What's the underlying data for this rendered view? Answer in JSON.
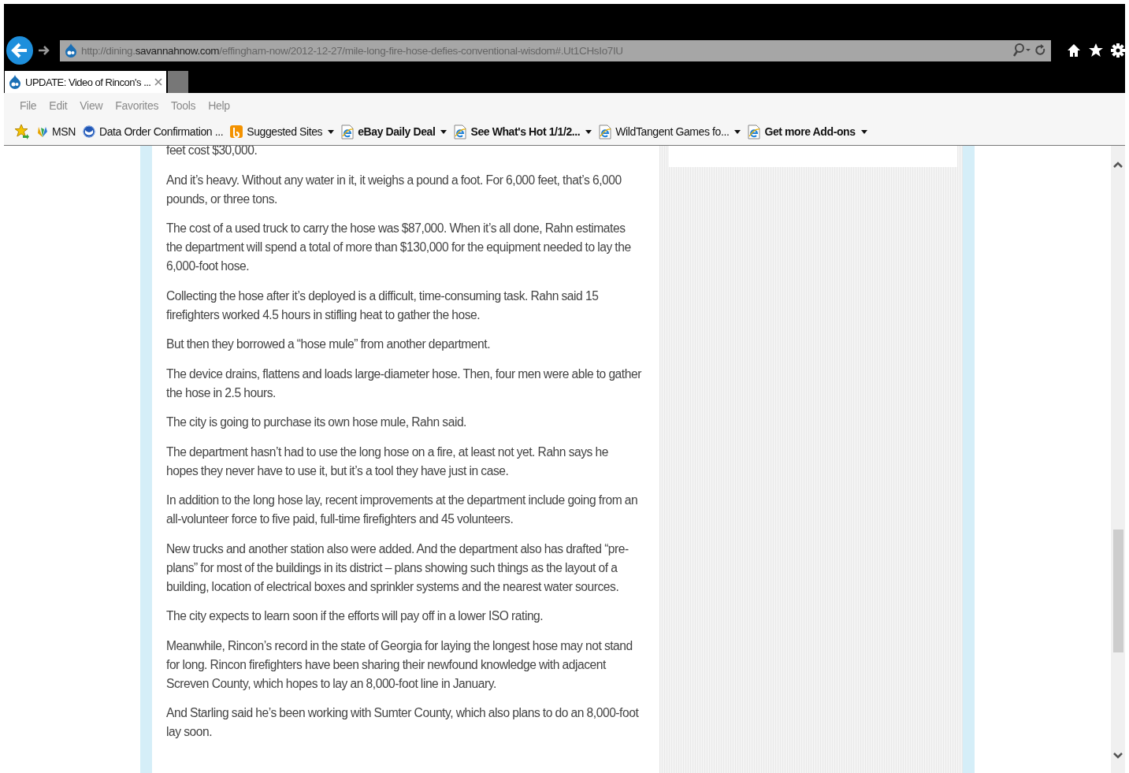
{
  "browser": {
    "address": "http://dining.**savannahnow.com**/effingham-now/2012-12-27/mile-long-fire-hose-defies-conventional-wisdom#.Ut1CHsIo7IU",
    "tabs": [
      {
        "title": "UPDATE: Video of Rincon's ...",
        "selected": true
      }
    ],
    "menu": [
      "File",
      "Edit",
      "View",
      "Favorites",
      "Tools",
      "Help"
    ],
    "favorites": [
      {
        "label": "MSN",
        "kind": "msn",
        "bold": false,
        "dropdown": false
      },
      {
        "label": "Data Order Confirmation ...",
        "kind": "globe",
        "bold": false,
        "dropdown": false
      },
      {
        "label": "Suggested Sites",
        "kind": "suggested",
        "bold": false,
        "dropdown": true
      },
      {
        "label": "eBay Daily Deal",
        "kind": "page",
        "bold": true,
        "dropdown": true
      },
      {
        "label": "See What's Hot 1/1/2...",
        "kind": "page",
        "bold": true,
        "dropdown": true
      },
      {
        "label": "WildTangent Games fo...",
        "kind": "page",
        "bold": false,
        "dropdown": true
      },
      {
        "label": "Get more Add-ons",
        "kind": "page",
        "bold": true,
        "dropdown": true
      }
    ]
  },
  "article": {
    "paragraphs": [
      "feet cost $30,000.",
      "And it’s heavy. Without any water in it, it weighs a pound a foot. For 6,000 feet, that’s 6,000 pounds, or three tons.",
      "The cost of a used truck to carry the hose was $87,000. When it’s all done, Rahn estimates the department will spend a total of more than $130,000 for the equipment needed to lay the 6,000-foot hose.",
      "Collecting the hose after it’s deployed is a difficult, time-consuming task. Rahn said 15 firefighters worked 4.5 hours in stifling heat to gather the hose.",
      "But then they borrowed a “hose mule” from another department.",
      "The device drains, flattens and loads large-diameter hose. Then, four men were able to gather the hose in 2.5 hours.",
      "The city is going to purchase its own hose mule, Rahn said.",
      "The department hasn’t had to use the long hose on a fire, at least not yet. Rahn says he hopes they never have to use it, but it’s a tool they have just in case.",
      "In addition to the long hose lay, recent improvements at the department include going from an all-volunteer force to five paid, full-time firefighters and 45 volunteers.",
      "New trucks and another station also were added. And the department also has drafted “pre-plans” for most of the buildings in its district – plans showing such things as the layout of a building, location of electrical boxes and sprinkler systems and the nearest water sources.",
      "The city expects to learn soon if the efforts will pay off in a lower ISO rating.",
      "Meanwhile, Rincon’s record in the state of Georgia for laying the longest hose may not stand for long. Rincon firefighters have been sharing their newfound knowledge with adjacent Screven County, which hopes to lay an 8,000-foot line in January.",
      "And Starling said he’s been working with Sumter County, which also plans to do an 8,000-foot lay soon."
    ]
  }
}
